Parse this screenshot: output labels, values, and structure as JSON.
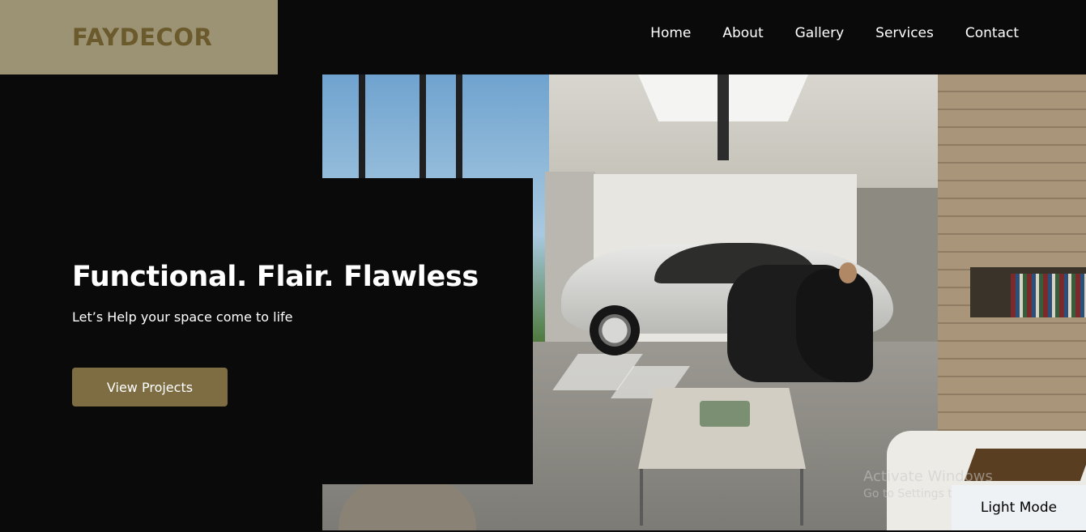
{
  "brand": {
    "logo_text": "FAYDECOR"
  },
  "nav": {
    "items": [
      {
        "label": "Home"
      },
      {
        "label": "About"
      },
      {
        "label": "Gallery"
      },
      {
        "label": "Services"
      },
      {
        "label": "Contact"
      }
    ]
  },
  "hero": {
    "title": "Functional. Flair. Flawless",
    "subtitle": "Let’s Help your space come to life",
    "cta_label": "View Projects",
    "image_icon": "interior-photo"
  },
  "theme_toggle": {
    "label": "Light Mode"
  },
  "os_watermark": {
    "title": "Activate Windows",
    "subtitle": "Go to Settings to activate Windows."
  },
  "colors": {
    "background": "#0a0a0a",
    "logo_box": "#9c9374",
    "logo_text": "#6b5a2c",
    "accent_button": "#7e6d42",
    "toggle_bg": "#eef2f5"
  }
}
